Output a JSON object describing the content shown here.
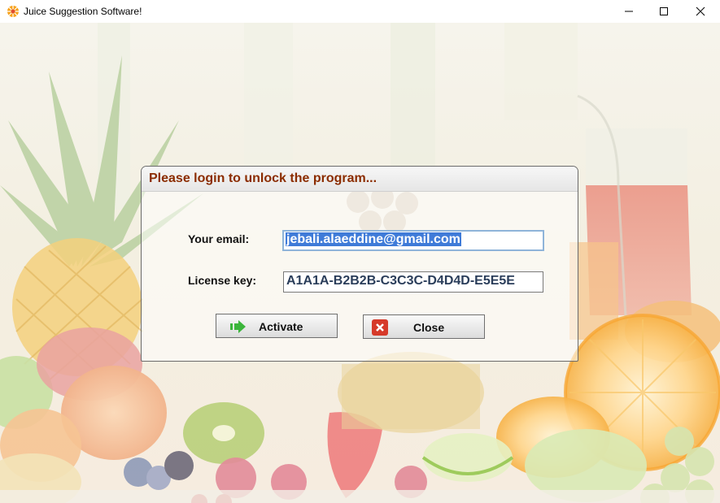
{
  "window": {
    "title": "Juice Suggestion Software!",
    "controls": [
      "minimize",
      "maximize",
      "close"
    ]
  },
  "dialog": {
    "title": "Please login to unlock the program...",
    "email_label": "Your email:",
    "email_value": "jebali.alaeddine@gmail.com",
    "license_label": "License key:",
    "license_value": "A1A1A-B2B2B-C3C3C-D4D4D-E5E5E",
    "activate_label": "Activate",
    "close_label": "Close",
    "activate_icon": "green-arrow-icon",
    "close_icon": "red-x-icon"
  },
  "colors": {
    "title_text": "#8b2c00",
    "field_text": "#2a3d5a",
    "selection": "#3f7bd8",
    "activate_icon": "#3bb53b",
    "close_icon": "#d63a2a"
  }
}
